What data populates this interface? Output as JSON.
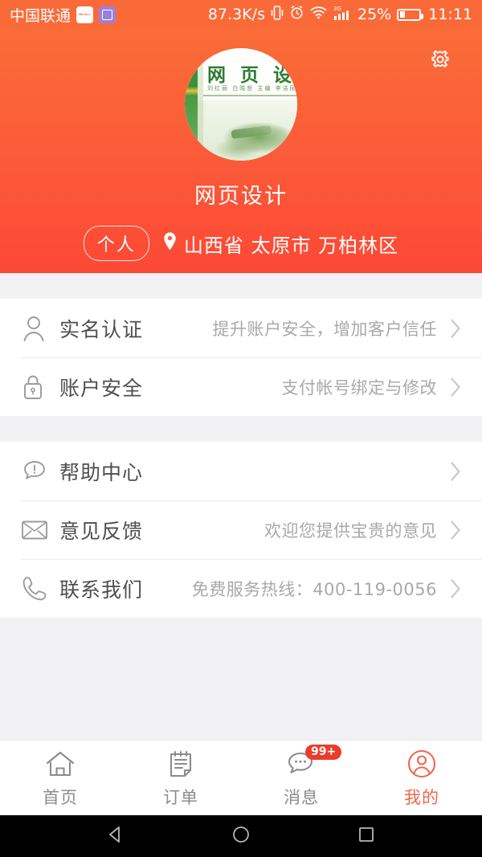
{
  "statusbar": {
    "carrier": "中国联通",
    "network_speed": "87.3K/s",
    "battery_percent": "25%",
    "time": "11:11",
    "signal_type": "3G"
  },
  "header": {
    "settings_label": "设置",
    "username": "网页设计",
    "avatar_book": {
      "title": "网 页 设 计",
      "authors": "刘红丽  白晓哲  主编    李洁民  林  薇  杨学军  副主编"
    },
    "account_type_badge": "个人",
    "location": "山西省 太原市 万柏林区",
    "gradient_top": "#FA6C37",
    "gradient_bottom": "#FC4835"
  },
  "menu_groups": [
    {
      "rows": [
        {
          "icon": "user-icon",
          "title": "实名认证",
          "desc": "提升账户安全，增加客户信任"
        },
        {
          "icon": "lock-icon",
          "title": "账户安全",
          "desc": "支付帐号绑定与修改"
        }
      ]
    },
    {
      "rows": [
        {
          "icon": "help-bubble-icon",
          "title": "帮助中心",
          "desc": ""
        },
        {
          "icon": "envelope-icon",
          "title": "意见反馈",
          "desc": "欢迎您提供宝贵的意见"
        },
        {
          "icon": "phone-icon",
          "title": "联系我们",
          "desc": "免费服务热线：400-119-0056"
        }
      ]
    }
  ],
  "tabbar": {
    "active_color": "#F0674C",
    "inactive_color": "#8C8C8C",
    "tabs": [
      {
        "icon": "home-icon",
        "label": "首页",
        "badge": ""
      },
      {
        "icon": "order-icon",
        "label": "订单",
        "badge": ""
      },
      {
        "icon": "message-icon",
        "label": "消息",
        "badge": "99+"
      },
      {
        "icon": "profile-icon",
        "label": "我的",
        "badge": ""
      }
    ]
  },
  "android_nav": {
    "back": "返回",
    "home": "主页",
    "recents": "最近任务"
  }
}
